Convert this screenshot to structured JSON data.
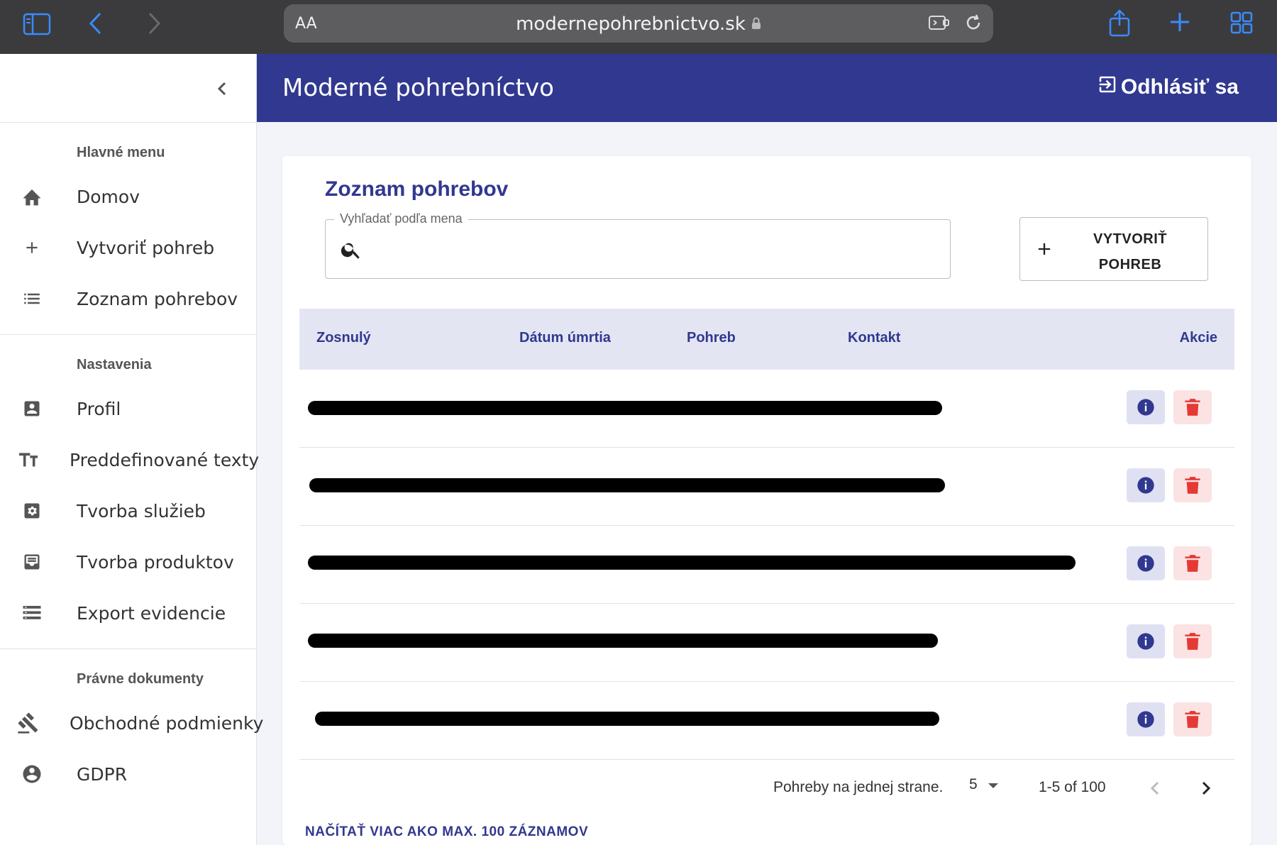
{
  "browser": {
    "url": "modernepohrebnictvo.sk",
    "text_size_label": "AA"
  },
  "sidebar": {
    "sections": [
      {
        "title": "Hlavné menu",
        "items": [
          {
            "label": "Domov",
            "icon": "home-icon"
          },
          {
            "label": "Vytvoriť pohreb",
            "icon": "plus-icon"
          },
          {
            "label": "Zoznam pohrebov",
            "icon": "list-icon"
          }
        ]
      },
      {
        "title": "Nastavenia",
        "items": [
          {
            "label": "Profil",
            "icon": "profile-icon"
          },
          {
            "label": "Preddefinované texty",
            "icon": "text-size-icon"
          },
          {
            "label": "Tvorba služieb",
            "icon": "settings-box-icon"
          },
          {
            "label": "Tvorba produktov",
            "icon": "inbox-icon"
          },
          {
            "label": "Export evidencie",
            "icon": "storage-icon"
          }
        ]
      },
      {
        "title": "Právne dokumenty",
        "items": [
          {
            "label": "Obchodné podmienky",
            "icon": "gavel-icon"
          },
          {
            "label": "GDPR",
            "icon": "account-circle-icon"
          }
        ]
      }
    ]
  },
  "header": {
    "title": "Moderné pohrebníctvo",
    "logout_label": "Odhlásiť sa"
  },
  "main": {
    "title": "Zoznam pohrebov",
    "search": {
      "legend": "Vyhľadať podľa mena",
      "value": ""
    },
    "create_button": {
      "line1": "VYTVORIŤ",
      "line2": "POHREB"
    },
    "table": {
      "columns": [
        "Zosnulý",
        "Dátum úmrtia",
        "Pohreb",
        "Kontakt",
        "Akcie"
      ],
      "row_count": 5
    },
    "pagination": {
      "rows_per_page_label": "Pohreby na jednej strane.",
      "rows_per_page": "5",
      "range": "1-5 of 100"
    },
    "load_more_label": "NAČÍTAŤ VIAC AKO MAX. 100 ZÁZNAMOV"
  },
  "colors": {
    "primary": "#31388f",
    "table_header_bg": "#e3e5f3",
    "info_button_bg": "#dfe1f3",
    "delete_button_bg": "#fbe3e3",
    "delete_icon": "#e53935",
    "browser_accent": "#3a8bff"
  }
}
